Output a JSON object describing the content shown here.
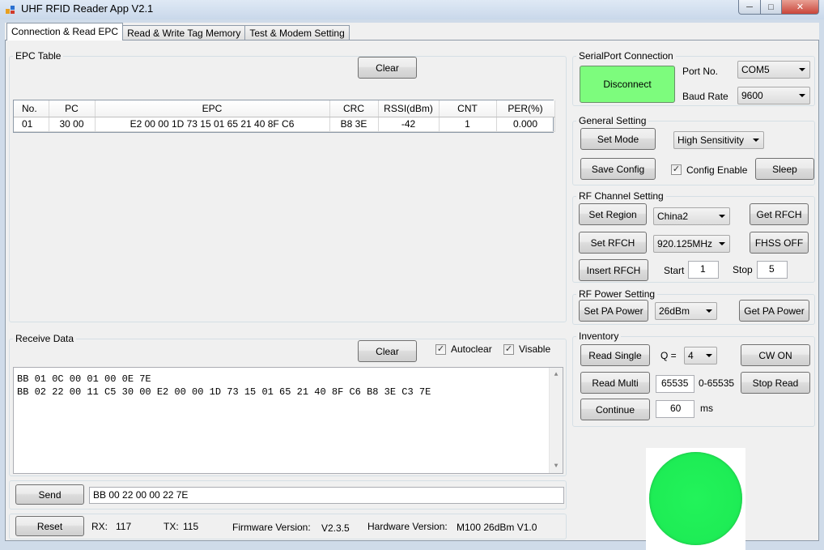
{
  "window": {
    "title": "UHF RFID Reader App V2.1"
  },
  "tabs": [
    {
      "label": "Connection & Read EPC",
      "active": true
    },
    {
      "label": "Read & Write Tag Memory",
      "active": false
    },
    {
      "label": "Test & Modem Setting",
      "active": false
    }
  ],
  "epc_table": {
    "title": "EPC Table",
    "clear_label": "Clear",
    "columns": [
      "No.",
      "PC",
      "EPC",
      "CRC",
      "RSSI(dBm)",
      "CNT",
      "PER(%)"
    ],
    "rows": [
      [
        "01",
        "30 00",
        "E2 00 00 1D 73 15 01 65 21 40 8F C6",
        "B8 3E",
        "-42",
        "1",
        "0.000"
      ]
    ]
  },
  "receive": {
    "title": "Receive Data",
    "clear_label": "Clear",
    "autoclear_label": "Autoclear",
    "autoclear_checked": true,
    "visable_label": "Visable",
    "visable_checked": true,
    "lines": [
      "BB 01 0C 00 01 00 0E 7E",
      "BB 02 22 00 11 C5 30 00 E2 00 00 1D 73 15 01 65 21 40 8F C6 B8 3E C3 7E"
    ]
  },
  "send": {
    "button_label": "Send",
    "value": "BB 00 22 00 00 22 7E"
  },
  "status_bar": {
    "reset_label": "Reset",
    "rx_label": "RX:",
    "rx_value": "117",
    "tx_label": "TX:",
    "tx_value": "115",
    "firmware_label": "Firmware Version:",
    "firmware_value": "V2.3.5",
    "hardware_label": "Hardware Version:",
    "hardware_value": "M100 26dBm V1.0"
  },
  "serial": {
    "title": "SerialPort Connection",
    "connect_label": "Disconnect",
    "port_label": "Port No.",
    "port_value": "COM5",
    "baud_label": "Baud Rate",
    "baud_value": "9600",
    "connected_color": "#7dfc7d"
  },
  "general": {
    "title": "General Setting",
    "set_mode_label": "Set Mode",
    "mode_value": "High Sensitivity",
    "save_config_label": "Save Config",
    "config_enable_label": "Config Enable",
    "config_enable_checked": true,
    "sleep_label": "Sleep"
  },
  "rf_channel": {
    "title": "RF Channel Setting",
    "set_region_label": "Set Region",
    "region_value": "China2",
    "get_rfch_label": "Get RFCH",
    "set_rfch_label": "Set RFCH",
    "rfch_value": "920.125MHz",
    "fhss_label": "FHSS OFF",
    "insert_rfch_label": "Insert RFCH",
    "start_label": "Start",
    "start_value": "1",
    "stop_label": "Stop",
    "stop_value": "5"
  },
  "rf_power": {
    "title": "RF Power Setting",
    "set_pa_label": "Set PA Power",
    "pa_value": "26dBm",
    "get_pa_label": "Get PA Power"
  },
  "inventory": {
    "title": "Inventory",
    "read_single_label": "Read Single",
    "q_label": "Q =",
    "q_value": "4",
    "cw_on_label": "CW ON",
    "read_multi_label": "Read Multi",
    "multi_count_value": "65535",
    "multi_range_label": "0-65535",
    "stop_read_label": "Stop Read",
    "continue_label": "Continue",
    "interval_value": "60",
    "interval_unit": "ms"
  },
  "indicator": {
    "color": "#1eec55"
  }
}
